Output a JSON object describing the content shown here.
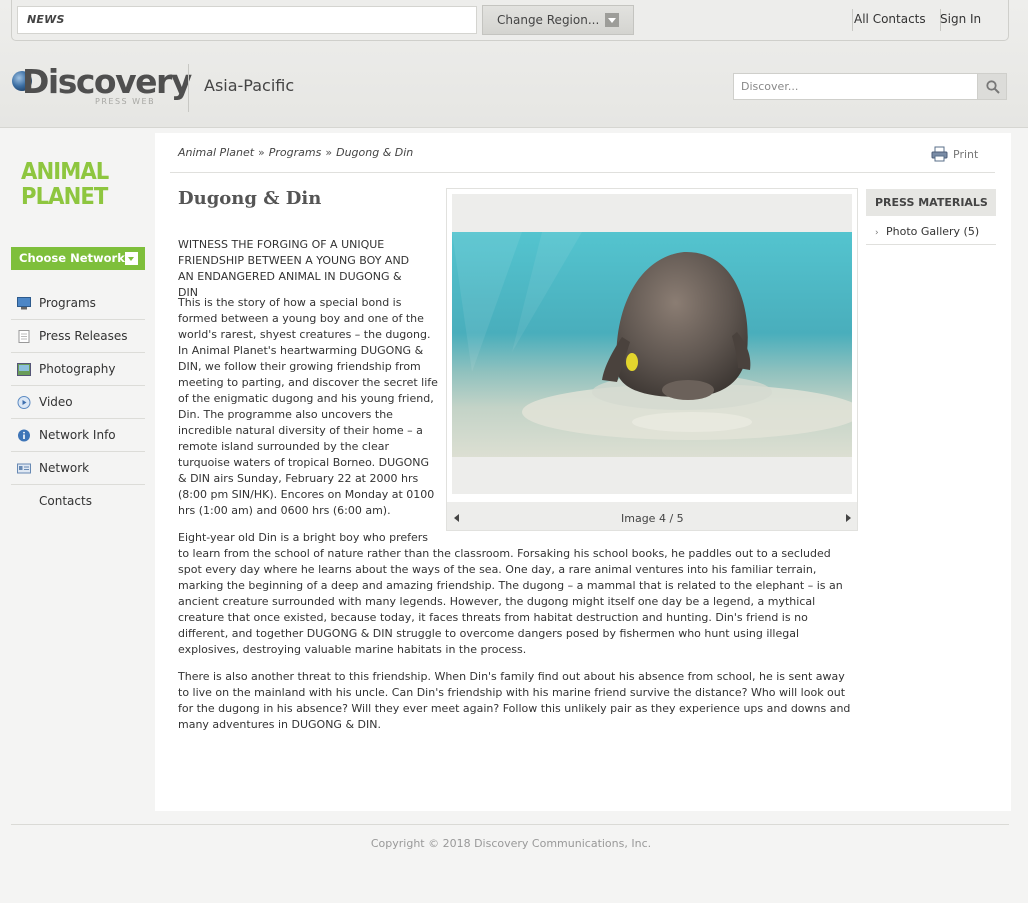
{
  "topbar": {
    "news_label": "NEWS",
    "region_button": "Change Region...",
    "all_contacts": "All Contacts",
    "sign_in": "Sign In"
  },
  "header": {
    "logo_text": "Discovery",
    "logo_sub": "PRESS WEB",
    "region_name": "Asia-Pacific",
    "search_placeholder": "Discover..."
  },
  "sidebar": {
    "network_logo_line1": "ANIMAL",
    "network_logo_line2": "PLANET",
    "choose_network": "Choose Network...",
    "items": [
      {
        "label": "Programs",
        "icon": "monitor-icon"
      },
      {
        "label": "Press Releases",
        "icon": "document-icon"
      },
      {
        "label": "Photography",
        "icon": "picture-icon"
      },
      {
        "label": "Video",
        "icon": "play-icon"
      },
      {
        "label": "Network Info",
        "icon": "info-icon"
      },
      {
        "label": "Network Contacts",
        "icon": "contact-card-icon"
      }
    ]
  },
  "breadcrumb": {
    "items": [
      "Animal Planet",
      "Programs",
      "Dugong & Din"
    ],
    "separator": "»"
  },
  "print_label": "Print",
  "article": {
    "title": "Dugong & Din",
    "lead": "WITNESS THE FORGING OF A UNIQUE FRIENDSHIP BETWEEN A YOUNG BOY AND AN ENDANGERED ANIMAL IN DUGONG & DIN",
    "para1": "This is the story of how a special bond is formed between a young boy and one of the world's rarest, shyest creatures – the dugong. In Animal Planet's heartwarming DUGONG & DIN, we follow their growing friendship from meeting to parting, and discover the secret life of the enigmatic dugong and his young friend, Din. The programme also uncovers the incredible natural diversity of their home – a remote island surrounded by the clear turquoise waters of tropical Borneo. DUGONG & DIN airs Sunday, February 22 at 2000 hrs (8:00 pm SIN/HK). Encores on Monday at 0100 hrs (1:00 am) and 0600 hrs (6:00 am).",
    "para2_first_line": "Eight-year old Din is a bright boy who prefers",
    "para2_rest": "to learn from the school of nature rather than the classroom. Forsaking his school books, he paddles out to a secluded spot every day where he learns about the ways of the sea. One day, a rare animal ventures into his familiar terrain, marking the beginning of a deep and amazing friendship. The dugong – a mammal that is related to the elephant – is an ancient creature surrounded with many legends. However, the dugong might itself one day be a legend, a mythical creature that once existed, because today, it faces threats from habitat destruction and hunting. Din's friend is no different, and together DUGONG & DIN struggle to overcome dangers posed by fishermen who hunt using illegal explosives, destroying valuable marine habitats in the process.",
    "para3": "There is also another threat to this friendship. When Din's family find out about his absence from school, he is sent away to live on the mainland with his uncle. Can Din's friendship with his marine friend survive the distance? Who will look out for the dugong in his absence? Will they ever meet again? Follow this unlikely pair as they experience ups and downs and many adventures in DUGONG & DIN."
  },
  "gallery": {
    "counter": "Image 4 / 5"
  },
  "press_materials": {
    "heading": "PRESS MATERIALS",
    "items": [
      "Photo Gallery (5)"
    ]
  },
  "footer": {
    "copyright": "Copyright © 2018 Discovery Communications, Inc."
  },
  "colors": {
    "accent_green": "#7ebf3b",
    "animal_planet_green": "#8ec63f"
  }
}
